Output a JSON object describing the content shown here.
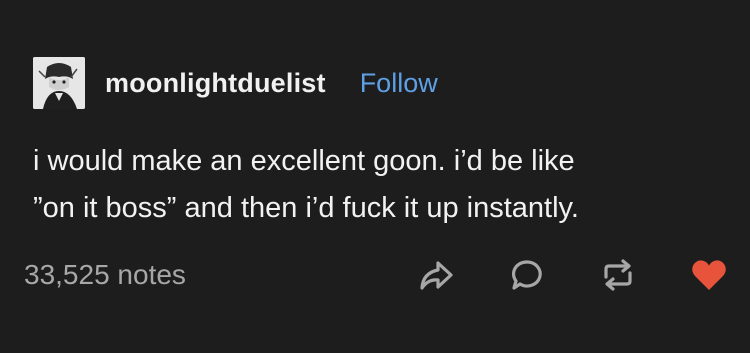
{
  "post": {
    "username": "moonlightduelist",
    "follow_label": "Follow",
    "body": "i would make an excellent goon. i’d be like\n”on it boss” and then i’d fuck it up instantly.",
    "notes": "33,525 notes"
  },
  "icons": {
    "share": "share-arrow-icon",
    "reply": "reply-bubble-icon",
    "reblog": "reblog-icon",
    "like": "heart-icon"
  },
  "colors": {
    "background": "#1d1d1d",
    "follow": "#5e9fe6",
    "like": "#e8533c",
    "icon": "#a7a7a7"
  }
}
